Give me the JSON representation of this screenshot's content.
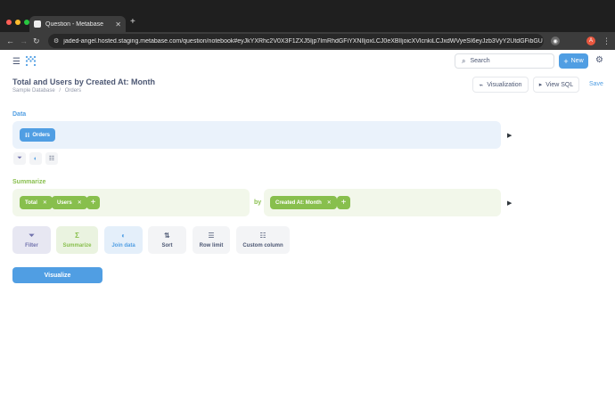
{
  "browser": {
    "tab_title": "Question - Metabase",
    "url": "jaded-angel.hosted.staging.metabase.com/question/notebook#eyJkYXRhc2V0X3F1ZXJ5Ijp7ImRhdGFiYXNlIjoxLCJ0eXBlIjoicXVlcnkiLCJxdWVyeSI6eyJzb3VyY2UtdGFibGU",
    "profile_initial": "A"
  },
  "header": {
    "search_placeholder": "Search",
    "new_label": "New",
    "title": "Total and Users by Created At: Month",
    "breadcrumb_db": "Sample Database",
    "breadcrumb_sep": "/",
    "breadcrumb_table": "Orders",
    "visualization_label": "Visualization",
    "view_sql_label": "View SQL",
    "save_label": "Save"
  },
  "notebook": {
    "data_label": "Data",
    "table_name": "Orders",
    "summarize_label": "Summarize",
    "metrics": [
      "Total",
      "Users"
    ],
    "by_label": "by",
    "breakouts": [
      "Created At: Month"
    ],
    "actions": {
      "filter": "Filter",
      "summarize": "Summarize",
      "join": "Join data",
      "sort": "Sort",
      "limit": "Row limit",
      "custom": "Custom column"
    },
    "visualize_label": "Visualize"
  },
  "colors": {
    "brand": "#509ee3",
    "summarize": "#88bf4d",
    "filter": "#7172ad",
    "text": "#4c5773"
  }
}
